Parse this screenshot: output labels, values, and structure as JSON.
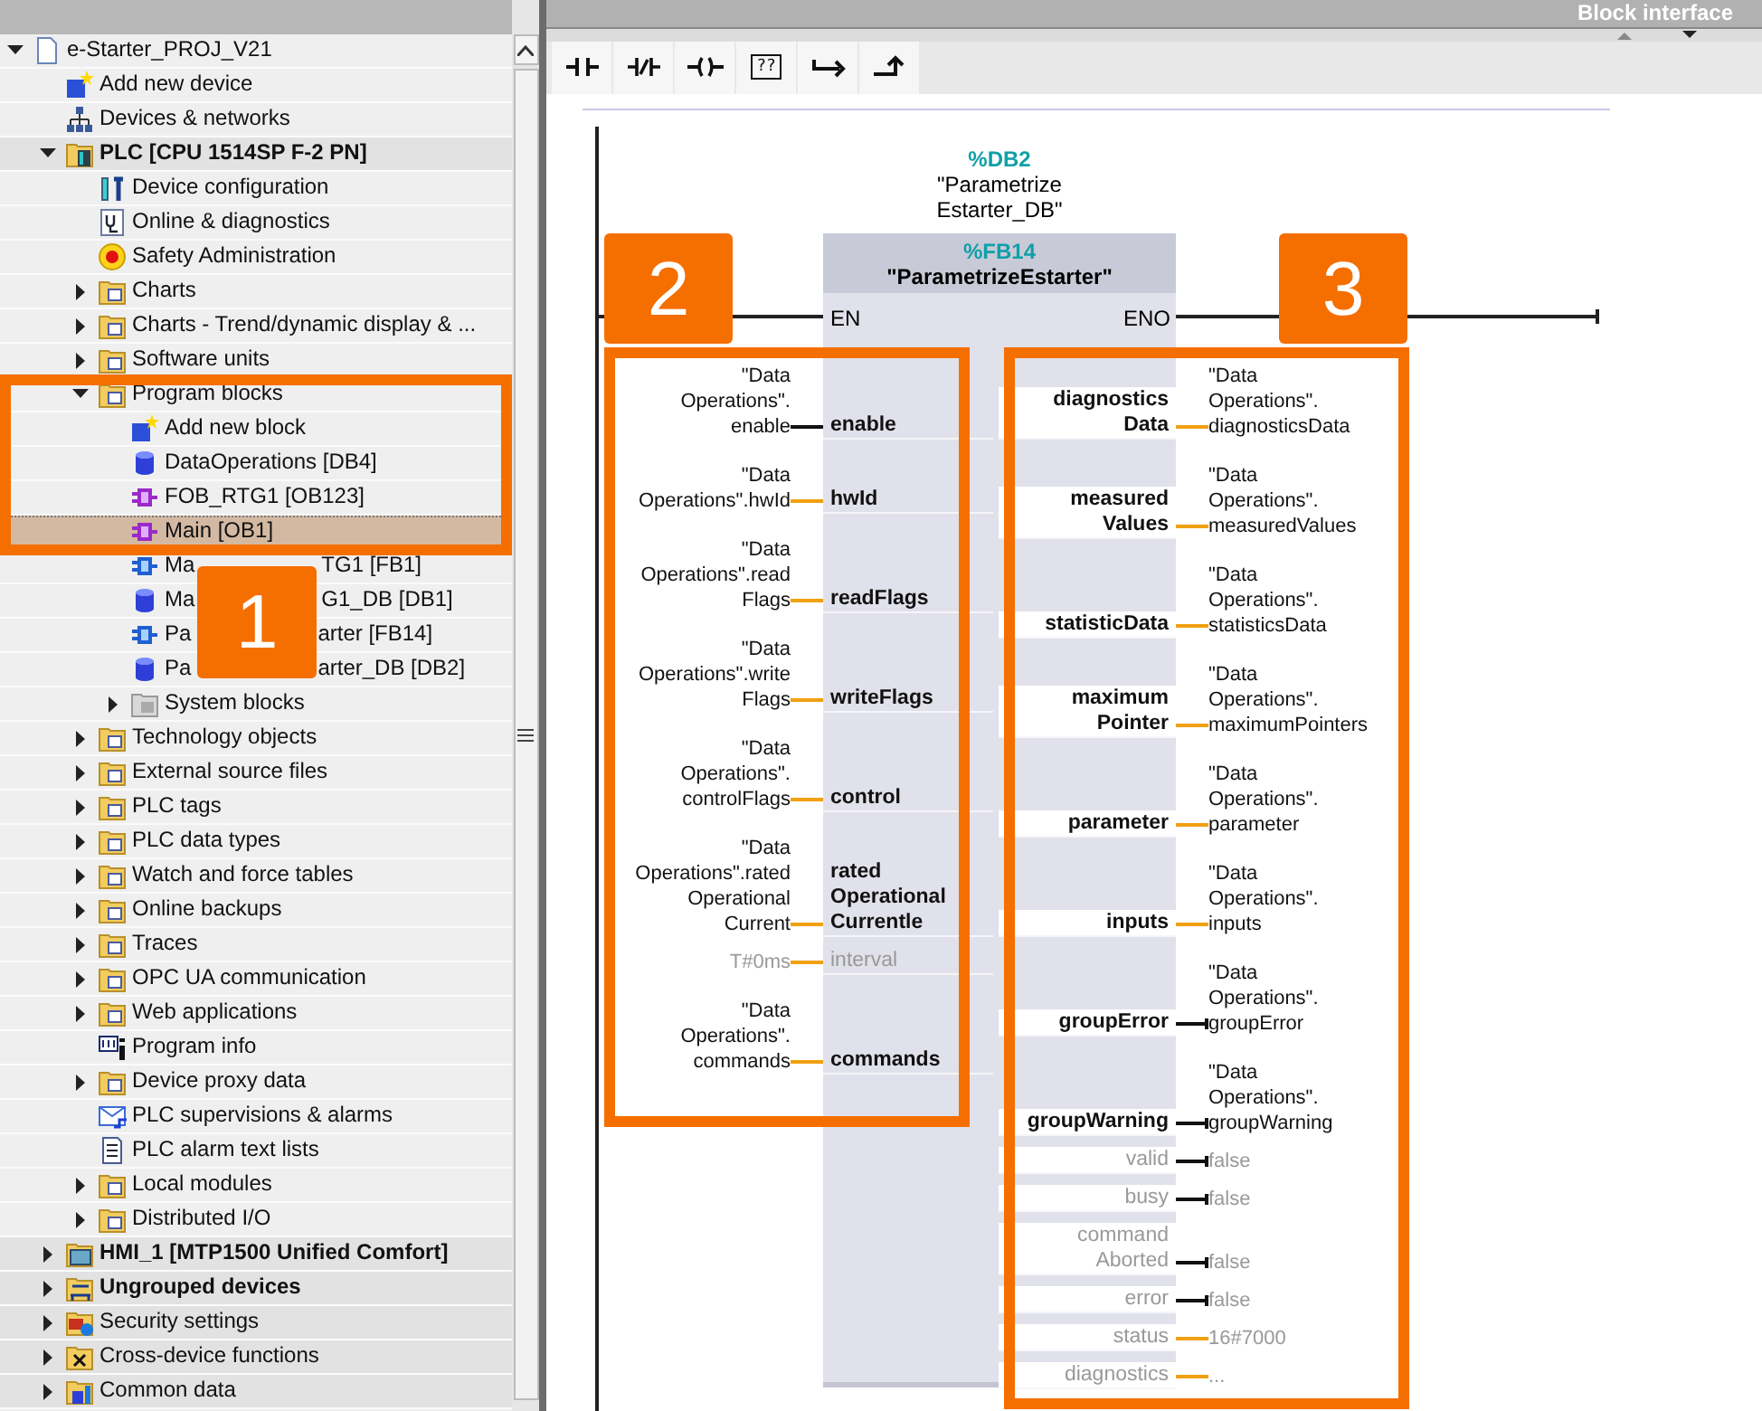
{
  "top_bar": {
    "title": "Block interface"
  },
  "toolbar": {
    "buttons": [
      {
        "kind": "no_contact"
      },
      {
        "kind": "nc_contact"
      },
      {
        "kind": "coil"
      },
      {
        "kind": "empty_box",
        "label": "??"
      },
      {
        "kind": "open_branch"
      },
      {
        "kind": "close_branch"
      }
    ]
  },
  "project_tree": {
    "label": "e-Starter_PROJ_V21",
    "kind": "project",
    "expanded": true,
    "selected": false,
    "children": [
      {
        "label": "Add new device",
        "kind": "add",
        "selected": false
      },
      {
        "label": "Devices & networks",
        "kind": "network",
        "selected": false
      },
      {
        "label": "PLC [CPU 1514SP F-2 PN]",
        "kind": "plc",
        "expanded": true,
        "selected": false,
        "children": [
          {
            "label": "Device configuration",
            "kind": "config",
            "selected": false
          },
          {
            "label": "Online & diagnostics",
            "kind": "diag",
            "selected": false
          },
          {
            "label": "Safety Administration",
            "kind": "safety",
            "selected": false
          },
          {
            "label": "Charts",
            "kind": "folder",
            "expanded": false,
            "selected": false
          },
          {
            "label": "Charts - Trend/dynamic display & ...",
            "kind": "folder",
            "expanded": false,
            "selected": false
          },
          {
            "label": "Software units",
            "kind": "folder",
            "expanded": false,
            "selected": false
          },
          {
            "label": "Program blocks",
            "kind": "folder",
            "expanded": true,
            "selected": false,
            "children": [
              {
                "label": "Add new block",
                "kind": "add",
                "selected": false
              },
              {
                "label": "DataOperations [DB4]",
                "kind": "db",
                "selected": false
              },
              {
                "label": "FOB_RTG1 [OB123]",
                "kind": "ob",
                "selected": false
              },
              {
                "label": "Main [OB1]",
                "kind": "ob",
                "selected": true
              },
              {
                "label": "Ma",
                "label_tail": "TG1 [FB1]",
                "kind": "fb",
                "selected": false
              },
              {
                "label": "Ma",
                "label_tail": "G1_DB [DB1]",
                "kind": "db",
                "selected": false
              },
              {
                "label": "Pa",
                "label_tail": "arter [FB14]",
                "kind": "fb",
                "selected": false
              },
              {
                "label": "Pa",
                "label_tail": "arter_DB [DB2]",
                "kind": "db",
                "selected": false
              },
              {
                "label": "System blocks",
                "kind": "sys",
                "expanded": false,
                "selected": false
              }
            ]
          },
          {
            "label": "Technology objects",
            "kind": "folder",
            "expanded": false,
            "selected": false
          },
          {
            "label": "External source files",
            "kind": "folder",
            "expanded": false,
            "selected": false
          },
          {
            "label": "PLC tags",
            "kind": "folder",
            "expanded": false,
            "selected": false
          },
          {
            "label": "PLC data types",
            "kind": "folder",
            "expanded": false,
            "selected": false
          },
          {
            "label": "Watch and force tables",
            "kind": "folder",
            "expanded": false,
            "selected": false
          },
          {
            "label": "Online backups",
            "kind": "folder",
            "expanded": false,
            "selected": false
          },
          {
            "label": "Traces",
            "kind": "folder",
            "expanded": false,
            "selected": false
          },
          {
            "label": "OPC UA communication",
            "kind": "folder",
            "expanded": false,
            "selected": false
          },
          {
            "label": "Web applications",
            "kind": "folder",
            "expanded": false,
            "selected": false
          },
          {
            "label": "Program info",
            "kind": "info",
            "selected": false
          },
          {
            "label": "Device proxy data",
            "kind": "folder",
            "expanded": false,
            "selected": false
          },
          {
            "label": "PLC supervisions & alarms",
            "kind": "alarm",
            "selected": false
          },
          {
            "label": "PLC alarm text lists",
            "kind": "textlist",
            "selected": false
          },
          {
            "label": "Local modules",
            "kind": "folder",
            "expanded": false,
            "selected": false
          },
          {
            "label": "Distributed I/O",
            "kind": "folder",
            "expanded": false,
            "selected": false
          }
        ]
      },
      {
        "label": "HMI_1 [MTP1500 Unified Comfort]",
        "kind": "hmi",
        "expanded": false,
        "selected": false
      },
      {
        "label": "Ungrouped devices",
        "kind": "ungrouped",
        "expanded": false,
        "selected": false
      },
      {
        "label": "Security settings",
        "kind": "security",
        "expanded": false,
        "selected": false
      },
      {
        "label": "Cross-device functions",
        "kind": "crossdevice",
        "expanded": false,
        "selected": false
      },
      {
        "label": "Common data",
        "kind": "common",
        "expanded": false,
        "selected": false
      }
    ]
  },
  "network": {
    "instance_db": {
      "address": "%DB2",
      "name": "\"Parametrize\nEstarter_DB\""
    },
    "block": {
      "address": "%FB14",
      "name": "\"ParametrizeEstarter\"",
      "en": "EN",
      "eno": "ENO"
    },
    "inputs": [
      {
        "name": "enable",
        "param": "\"Data\nOperations\".\nenable",
        "kind": "bool",
        "disabled": false
      },
      {
        "name": "hwId",
        "param": "\"Data\nOperations\".hwId",
        "kind": "data",
        "disabled": false
      },
      {
        "name": "readFlags",
        "param": "\"Data\nOperations\".read\nFlags",
        "kind": "data",
        "disabled": false
      },
      {
        "name": "writeFlags",
        "param": "\"Data\nOperations\".write\nFlags",
        "kind": "data",
        "disabled": false
      },
      {
        "name": "control",
        "param": "\"Data\nOperations\".\ncontrolFlags",
        "kind": "data",
        "disabled": false
      },
      {
        "name": "rated\nOperational\nCurrentle",
        "param": "\"Data\nOperations\".rated\nOperational\nCurrent",
        "kind": "data",
        "disabled": false
      },
      {
        "name": "interval",
        "param": "T#0ms",
        "kind": "data",
        "disabled": true
      },
      {
        "name": "commands",
        "param": "\"Data\nOperations\".\ncommands",
        "kind": "data",
        "disabled": false
      }
    ],
    "outputs": [
      {
        "name": "diagnostics\nData",
        "param": "\"Data\nOperations\".\ndiagnosticsData",
        "kind": "data",
        "disabled": false
      },
      {
        "name": "measured\nValues",
        "param": "\"Data\nOperations\".\nmeasuredValues",
        "kind": "data",
        "disabled": false
      },
      {
        "name": "statisticData",
        "param": "\"Data\nOperations\".\nstatisticsData",
        "kind": "data",
        "disabled": false
      },
      {
        "name": "maximum\nPointer",
        "param": "\"Data\nOperations\".\nmaximumPointers",
        "kind": "data",
        "disabled": false
      },
      {
        "name": "parameter",
        "param": "\"Data\nOperations\".\nparameter",
        "kind": "data",
        "disabled": false
      },
      {
        "name": "inputs",
        "param": "\"Data\nOperations\".\ninputs",
        "kind": "data",
        "disabled": false
      },
      {
        "name": "groupError",
        "param": "\"Data\nOperations\".\ngroupError",
        "kind": "bool",
        "disabled": false
      },
      {
        "name": "groupWarning",
        "param": "\"Data\nOperations\".\ngroupWarning",
        "kind": "bool",
        "disabled": false
      },
      {
        "name": "valid",
        "param": "false",
        "kind": "bool",
        "disabled": true
      },
      {
        "name": "busy",
        "param": "false",
        "kind": "bool",
        "disabled": true
      },
      {
        "name": "command\nAborted",
        "param": "false",
        "kind": "bool",
        "disabled": true
      },
      {
        "name": "error",
        "param": "false",
        "kind": "bool",
        "disabled": true
      },
      {
        "name": "status",
        "param": "16#7000",
        "kind": "data",
        "disabled": true
      },
      {
        "name": "diagnostics",
        "param": "...",
        "kind": "data",
        "disabled": true
      }
    ]
  },
  "callouts": [
    {
      "number": "1"
    },
    {
      "number": "2"
    },
    {
      "number": "3"
    }
  ]
}
